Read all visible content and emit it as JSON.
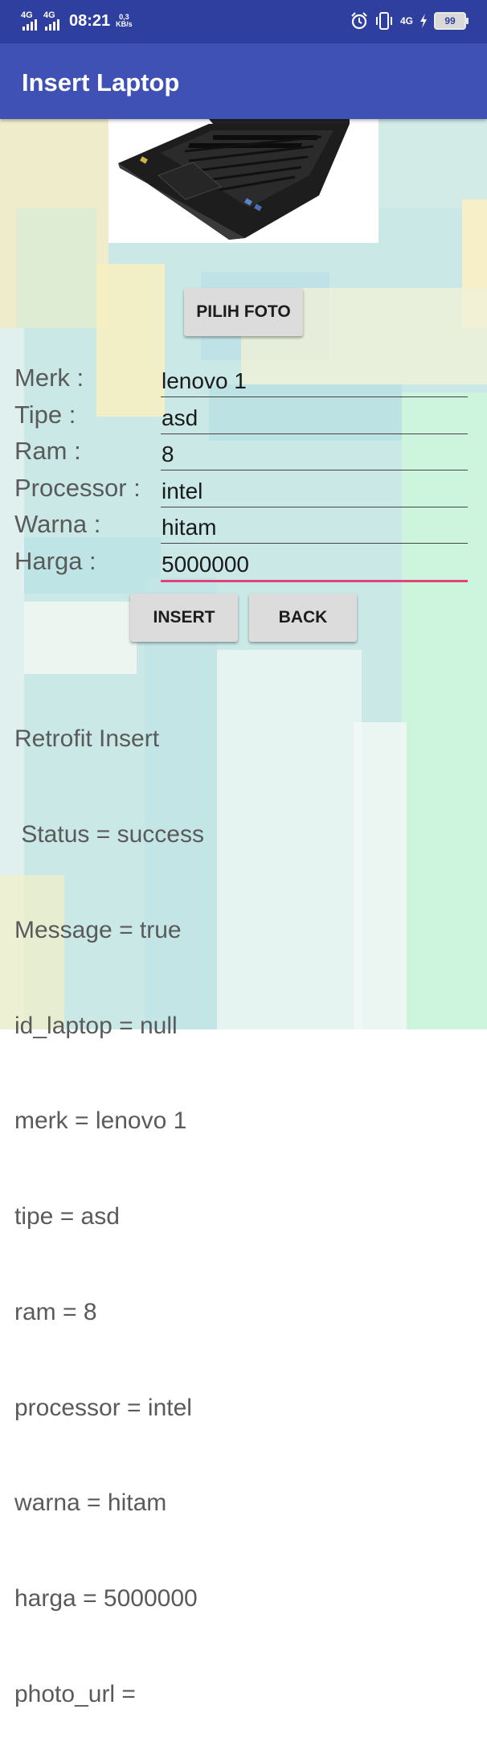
{
  "status_bar": {
    "network_1": "4G",
    "network_2": "4G",
    "time": "08:21",
    "speed_value": "0,3",
    "speed_unit": "KB/s",
    "right_network": "4G",
    "battery_level": "99"
  },
  "app_bar": {
    "title": "Insert Laptop"
  },
  "buttons": {
    "choose_photo": "PILIH FOTO",
    "insert": "INSERT",
    "back": "BACK"
  },
  "form": {
    "merk_label": "Merk :",
    "merk_value": "lenovo 1",
    "tipe_label": "Tipe :",
    "tipe_value": "asd",
    "ram_label": "Ram :",
    "ram_value": "8",
    "processor_label": "Processor :",
    "processor_value": "intel",
    "warna_label": "Warna :",
    "warna_value": "hitam",
    "harga_label": "Harga :",
    "harga_value": "5000000"
  },
  "result_lines": [
    "Retrofit Insert",
    " Status = success",
    "Message = true",
    "id_laptop = null",
    "merk = lenovo 1",
    "tipe = asd",
    "ram = 8",
    "processor = intel",
    "warna = hitam",
    "harga = 5000000",
    "photo_url = "
  ],
  "icons": {
    "alarm": "alarm-icon",
    "vibrate": "vibrate-icon",
    "charging": "charging-icon",
    "battery": "battery-icon"
  },
  "colors": {
    "status_bar": "#2f3f9f",
    "app_bar": "#3f51b5",
    "button": "#dcdcdc",
    "focused_underline": "#e3417a"
  }
}
